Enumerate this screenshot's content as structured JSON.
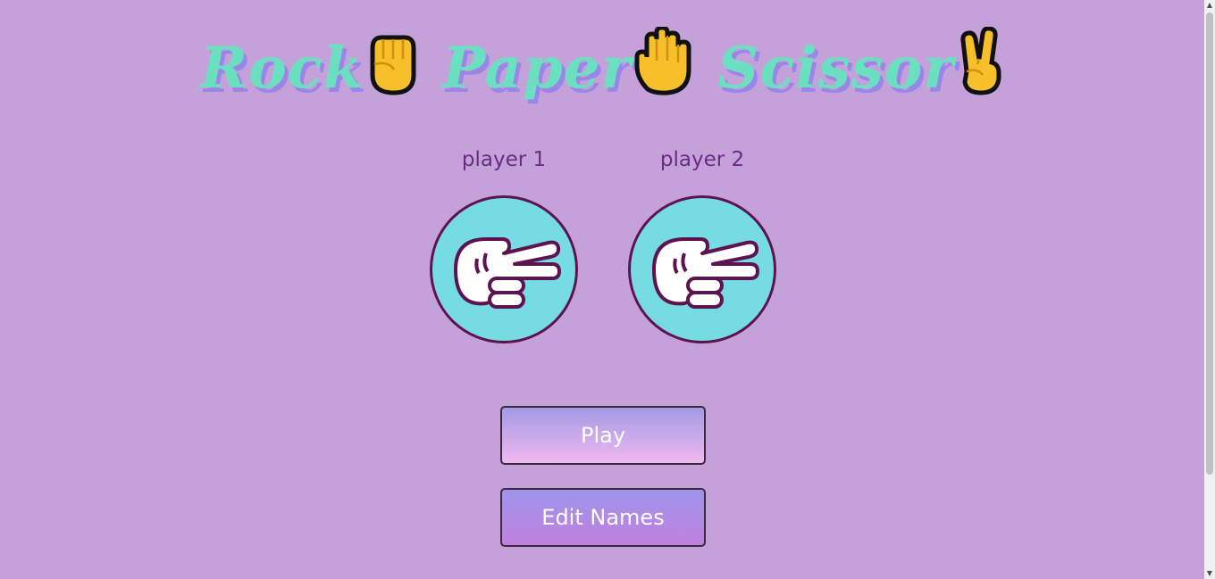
{
  "title": {
    "words": [
      "Rock",
      "Paper",
      "Scissor"
    ],
    "emoji_icons": [
      "raised-fist-icon",
      "raised-hand-icon",
      "victory-hand-icon"
    ]
  },
  "players": [
    {
      "name": "player 1",
      "hand_icon": "scissors-hand-icon"
    },
    {
      "name": "player 2",
      "hand_icon": "scissors-hand-icon"
    }
  ],
  "buttons": {
    "play_label": "Play",
    "edit_names_label": "Edit Names"
  },
  "colors": {
    "background": "#c5a1da",
    "title": "#6be0c1",
    "title_shadow": "#9a86e8",
    "player_label": "#6a2b86",
    "hand_circle_fill": "#76dbe2",
    "hand_circle_border": "#5e1351"
  }
}
